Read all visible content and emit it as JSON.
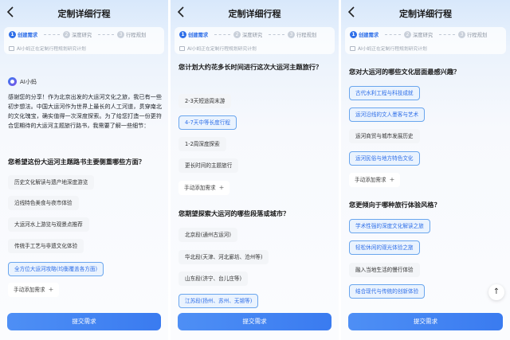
{
  "header": {
    "title": "定制详细行程"
  },
  "steps": [
    {
      "num": "1",
      "label": "创建需求"
    },
    {
      "num": "2",
      "label": "深度研究"
    },
    {
      "num": "3",
      "label": "行程规划"
    }
  ],
  "status_text": "AI小蚂正在定制行程规划研究计划",
  "assistant": {
    "name": "AI小蚂",
    "intro": "感谢您的分享！作为北京出发的大运河文化之旅，我已有一些初步想法。中国大运河作为世界上最长的人工河道，贯穿南北的文化瑰宝，确实值得一次深度探索。为了给您打造一份更符合您期待的大运河主题旅行路书，我需要了解一些细节："
  },
  "common": {
    "add_label": "手动添加需求",
    "add_icon": "plus-icon",
    "submit_label": "提交需求"
  },
  "panel1": {
    "question": "您希望这份大运河主题路书主要侧重哪些方面？",
    "options": [
      {
        "label": "历史文化解读与遗产地深度游览",
        "selected": false
      },
      {
        "label": "沿线特色美食与夜市体验",
        "selected": false
      },
      {
        "label": "大运河水上游览与观景点推荐",
        "selected": false
      },
      {
        "label": "传统手工艺与非遗文化体验",
        "selected": false
      },
      {
        "label": "全方位大运河攻略(均衡覆盖各方面)",
        "selected": true
      }
    ]
  },
  "panel2": {
    "question1": "您计划大约花多长时间进行这次大运河主题旅行？",
    "options1": [
      {
        "label": "2-3天短途周末游",
        "selected": false
      },
      {
        "label": "4-7天中等长度行程",
        "selected": true
      },
      {
        "label": "1-2周深度探索",
        "selected": false
      },
      {
        "label": "更长时间的主题旅行",
        "selected": false
      }
    ],
    "question2": "您期望探索大运河的哪些段落或城市？",
    "options2": [
      {
        "label": "北京段(通州古运河)",
        "selected": false
      },
      {
        "label": "华北段(天津、河北廊坊、沧州等)",
        "selected": false
      },
      {
        "label": "山东段(济宁、台儿庄等)",
        "selected": false
      },
      {
        "label": "江苏段(扬州、苏州、无锡等)",
        "selected": true
      }
    ]
  },
  "panel3": {
    "question1": "您对大运河的哪些文化层面最感兴趣？",
    "options1": [
      {
        "label": "古代水利工程与科技成就",
        "selected": true
      },
      {
        "label": "运河沿线的文人墨客与艺术",
        "selected": true
      },
      {
        "label": "运河商贸与城市发展历史",
        "selected": false
      },
      {
        "label": "运河民俗与地方特色文化",
        "selected": true
      }
    ],
    "question2": "您更倾向于哪种旅行体验风格？",
    "options2": [
      {
        "label": "学术性强的深度文化解读之旅",
        "selected": true
      },
      {
        "label": "轻松休闲的观光体验之旅",
        "selected": true
      },
      {
        "label": "融入当地生活的慢行体验",
        "selected": false
      },
      {
        "label": "结合现代与传统的创新体验",
        "selected": true
      }
    ],
    "fab_icon": "arrow-up-icon"
  },
  "colors": {
    "accent": "#2f6fe8",
    "selected_border": "#6aa6ee",
    "selected_bg": "#eaf3fe",
    "option_bg": "#f3f5f8"
  }
}
